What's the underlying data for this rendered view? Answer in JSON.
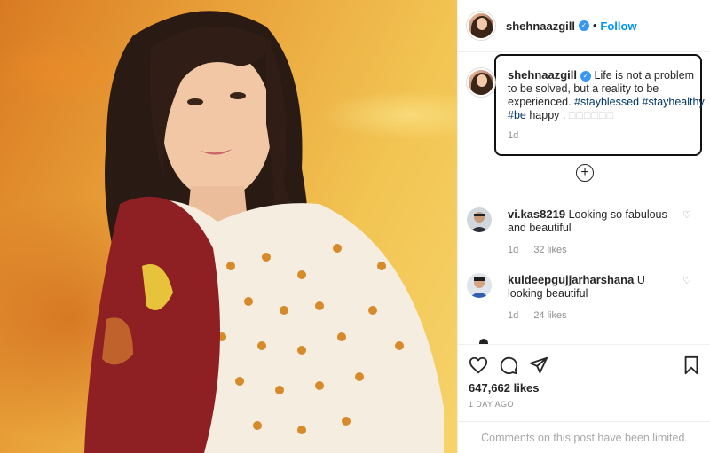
{
  "post": {
    "username": "shehnaazgill",
    "separator": "•",
    "follow_label": "Follow"
  },
  "caption": {
    "username": "shehnaazgill",
    "text": "Life is not a problem to be solved, but a reality to be experienced.",
    "hashtag_1": "#stayblessed",
    "hashtag_2": "#stayhealthy",
    "hashtag_3": "#be",
    "tail": "happy .",
    "emoji": "□□□□□□",
    "time": "1d"
  },
  "comments": [
    {
      "username": "vi.kas8219",
      "text": "Looking so fabulous and beautiful",
      "time": "1d",
      "likes": "32 likes"
    },
    {
      "username": "kuldeepgujjarharshana",
      "text": "U looking beautiful",
      "time": "1d",
      "likes": "24 likes"
    }
  ],
  "footer": {
    "likes": "647,662 likes",
    "time_ago": "1 DAY AGO",
    "comments_limited": "Comments on this post have been limited."
  },
  "icons": {
    "verified": "verified-badge-icon",
    "plus": "load-more-comments-icon",
    "like": "heart-icon",
    "comment": "comment-icon",
    "share": "paper-plane-icon",
    "save": "bookmark-icon"
  },
  "colors": {
    "accent": "#0095f6",
    "verified": "#3897f0",
    "hashtag": "#00376b",
    "muted": "#8e8e8e"
  }
}
